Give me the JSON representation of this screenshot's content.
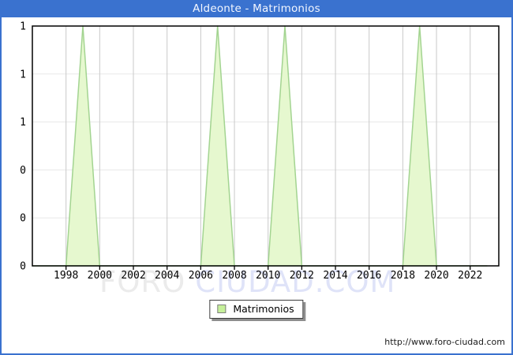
{
  "window": {
    "title": "Aldeonte - Matrimonios",
    "accent_color": "#3a72cf"
  },
  "watermark": {
    "left": "FORO",
    "right": "CIUDAD.COM"
  },
  "legend": {
    "label": "Matrimonios"
  },
  "footer": {
    "url": "http://www.foro-ciudad.com"
  },
  "chart_data": {
    "type": "area",
    "title": "Aldeonte - Matrimonios",
    "series_name": "Matrimonios",
    "x": [
      1996,
      1997,
      1998,
      1999,
      2000,
      2001,
      2002,
      2003,
      2004,
      2005,
      2006,
      2007,
      2008,
      2009,
      2010,
      2011,
      2012,
      2013,
      2014,
      2015,
      2016,
      2017,
      2018,
      2019,
      2020,
      2021,
      2022,
      2023
    ],
    "values": [
      0,
      0,
      0,
      1,
      0,
      0,
      0,
      0,
      0,
      0,
      0,
      1,
      0,
      0,
      0,
      1,
      0,
      0,
      0,
      0,
      0,
      0,
      0,
      1,
      0,
      0,
      0,
      0
    ],
    "xlim": [
      1996,
      2023.7
    ],
    "ylim": [
      0,
      1
    ],
    "x_ticks": [
      1998,
      2000,
      2002,
      2004,
      2006,
      2008,
      2010,
      2012,
      2014,
      2016,
      2018,
      2020,
      2022
    ],
    "y_ticks": [
      0,
      0.2,
      0.4,
      0.6,
      0.8,
      1
    ],
    "y_tick_labels": [
      "0",
      "0",
      "0",
      "1",
      "1",
      "1"
    ],
    "grid": true,
    "legend_position": "bottom-center",
    "colors": {
      "area_fill": "#e6f8cf",
      "area_stroke": "#a3d491",
      "grid_vertical": "#c9c9c9",
      "grid_horizontal": "#e8e8e8",
      "axis": "#000000",
      "tick_text": "#000000",
      "legend_swatch_fill": "#c6f09a",
      "legend_swatch_border": "#7f7f7f"
    }
  }
}
